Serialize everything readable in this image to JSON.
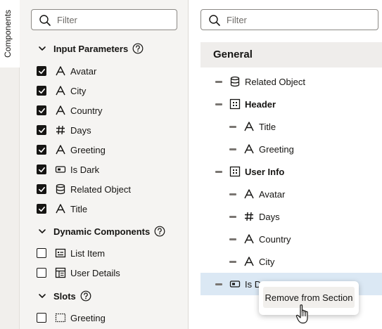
{
  "vertical_tab": {
    "label": "Components"
  },
  "left_panel": {
    "filter_placeholder": "Filter",
    "sections": {
      "input_parameters": {
        "title": "Input Parameters",
        "items": [
          {
            "label": "Avatar",
            "icon": "text-icon",
            "checked": true
          },
          {
            "label": "City",
            "icon": "text-icon",
            "checked": true
          },
          {
            "label": "Country",
            "icon": "text-icon",
            "checked": true
          },
          {
            "label": "Days",
            "icon": "hash-icon",
            "checked": true
          },
          {
            "label": "Greeting",
            "icon": "text-icon",
            "checked": true
          },
          {
            "label": "Is Dark",
            "icon": "toggle-icon",
            "checked": true
          },
          {
            "label": "Related Object",
            "icon": "database-icon",
            "checked": true
          },
          {
            "label": "Title",
            "icon": "text-icon",
            "checked": true
          }
        ]
      },
      "dynamic_components": {
        "title": "Dynamic Components",
        "items": [
          {
            "label": "List Item",
            "icon": "list-item-icon",
            "checked": false
          },
          {
            "label": "User Details",
            "icon": "user-details-icon",
            "checked": false
          }
        ]
      },
      "slots": {
        "title": "Slots",
        "items": [
          {
            "label": "Greeting",
            "icon": "slot-icon",
            "checked": false
          }
        ]
      }
    }
  },
  "right_panel": {
    "filter_placeholder": "Filter",
    "section_title": "General",
    "rows": [
      {
        "label": "Related Object",
        "icon": "database-icon",
        "bold": false
      },
      {
        "label": "Header",
        "icon": "grid-icon",
        "bold": true
      },
      {
        "label": "Title",
        "icon": "text-icon",
        "bold": false
      },
      {
        "label": "Greeting",
        "icon": "text-icon",
        "bold": false
      },
      {
        "label": "User Info",
        "icon": "grid-icon",
        "bold": true
      },
      {
        "label": "Avatar",
        "icon": "text-icon",
        "bold": false
      },
      {
        "label": "Days",
        "icon": "hash-icon",
        "bold": false
      },
      {
        "label": "Country",
        "icon": "text-icon",
        "bold": false
      },
      {
        "label": "City",
        "icon": "text-icon",
        "bold": false
      },
      {
        "label": "Is Da",
        "icon": "toggle-icon",
        "bold": false
      }
    ]
  },
  "context_menu": {
    "item": "Remove from Section"
  },
  "colors": {
    "selected_row": "#dbe8f4",
    "panel_bg": "#f5f4f2",
    "header_bg": "#efedeb"
  }
}
